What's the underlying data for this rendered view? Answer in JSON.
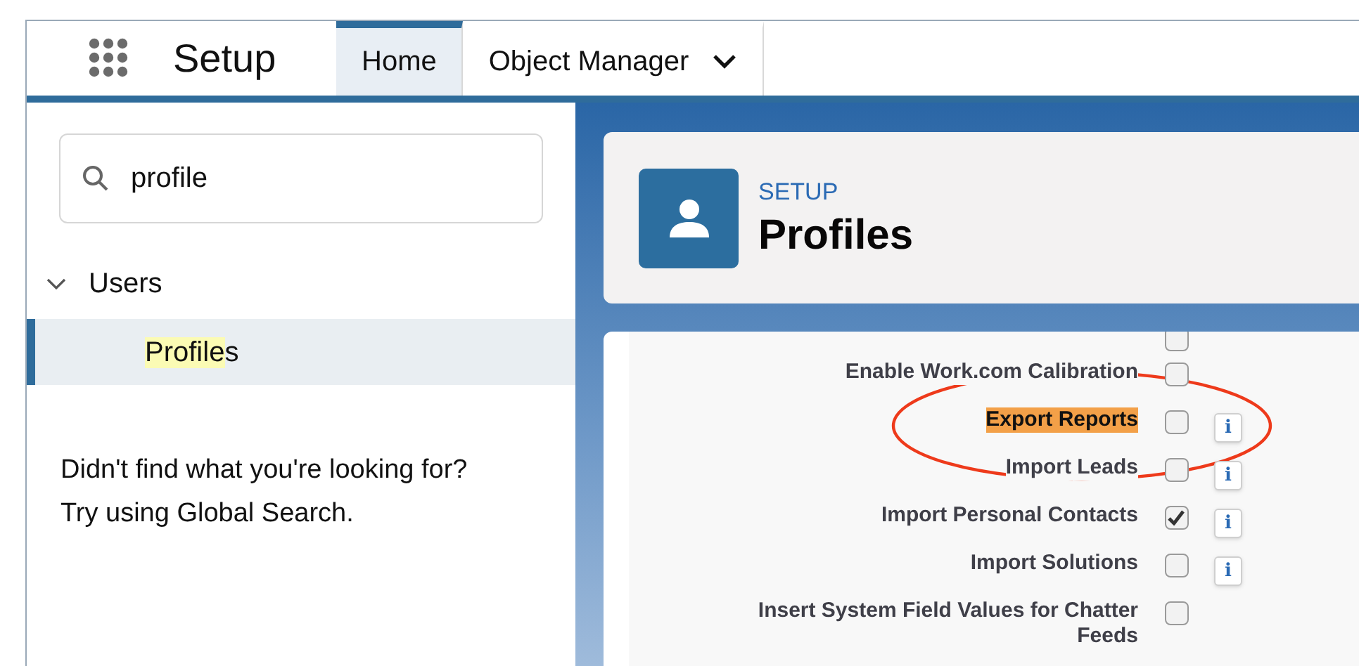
{
  "app": {
    "title": "Setup"
  },
  "tabs": [
    {
      "label": "Home",
      "selected": true,
      "dropdown": false
    },
    {
      "label": "Object Manager",
      "selected": false,
      "dropdown": true
    }
  ],
  "sidebar": {
    "search": {
      "value": "profile"
    },
    "tree": [
      {
        "label": "Users",
        "expanded": true,
        "children": [
          {
            "match": "Profile",
            "rest": "s",
            "selected": true
          }
        ]
      }
    ],
    "hint": [
      "Didn't find what you're looking for?",
      "Try using Global Search."
    ]
  },
  "page_header": {
    "eyebrow": "SETUP",
    "title": "Profiles"
  },
  "permissions": [
    {
      "checked": false
    },
    {
      "label": "Enable Work.com Calibration",
      "checked": false,
      "highlighted": false
    },
    {
      "label": "Export Reports",
      "checked": false,
      "info": "i",
      "highlighted": true
    },
    {
      "label": "Import Leads",
      "checked": false,
      "info": "i",
      "highlighted": false
    },
    {
      "label": "Import Personal Contacts",
      "checked": true,
      "info": "i",
      "highlighted": false
    },
    {
      "label": "Import Solutions",
      "checked": false,
      "info": "i",
      "highlighted": false
    },
    {
      "label": "Insert System Field Values for Chatter Feeds",
      "checked": false,
      "highlighted": false
    }
  ]
}
